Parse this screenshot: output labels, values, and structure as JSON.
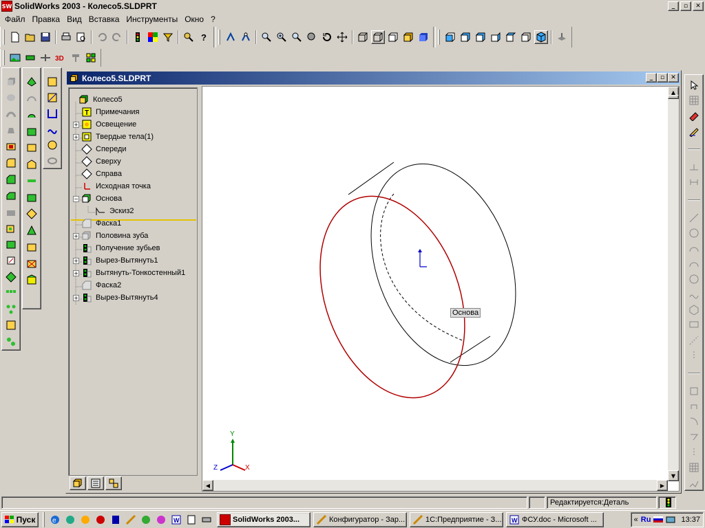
{
  "app": {
    "title": "SolidWorks 2003 - Колесо5.SLDPRT",
    "logo_text": "SW"
  },
  "menu": [
    "Файл",
    "Правка",
    "Вид",
    "Вставка",
    "Инструменты",
    "Окно",
    "?"
  ],
  "toolbar_top": [
    "new-document-icon",
    "open-icon",
    "save-icon",
    "print-icon",
    "print-preview-icon",
    "undo-icon",
    "redo-icon",
    "traffic-light-icon",
    "palette-icon",
    "options-icon",
    "select-icon",
    "help-icon",
    "zoom-fit-icon",
    "zoom-in-out-icon",
    "zoom-area-icon",
    "zoom-icon",
    "rotate-icon",
    "pan-icon",
    "wireframe-icon",
    "hidden-lines-visible-icon",
    "hidden-lines-removed-icon",
    "shaded-edges-icon",
    "shaded-icon",
    "front-view-icon",
    "back-view-icon",
    "left-view-icon",
    "right-view-icon",
    "top-view-icon",
    "isometric-view-icon",
    "normal-to-icon"
  ],
  "document": {
    "title": "Колесо5.SLDPRT",
    "tree": [
      {
        "label": "Колесо5",
        "icon": "part-icon",
        "indent": 0,
        "expand": ""
      },
      {
        "label": "Примечания",
        "icon": "annotations-icon",
        "indent": 1,
        "expand": ""
      },
      {
        "label": "Освещение",
        "icon": "lighting-icon",
        "indent": 1,
        "expand": "+"
      },
      {
        "label": "Твердые тела(1)",
        "icon": "solid-bodies-icon",
        "indent": 1,
        "expand": "+"
      },
      {
        "label": "Спереди",
        "icon": "plane-icon",
        "indent": 1,
        "expand": ""
      },
      {
        "label": "Сверху",
        "icon": "plane-icon",
        "indent": 1,
        "expand": ""
      },
      {
        "label": "Справа",
        "icon": "plane-icon",
        "indent": 1,
        "expand": ""
      },
      {
        "label": "Исходная точка",
        "icon": "origin-icon",
        "indent": 1,
        "expand": ""
      },
      {
        "label": "Основа",
        "icon": "extrude-icon",
        "indent": 1,
        "expand": "−"
      },
      {
        "label": "Эскиз2",
        "icon": "sketch-icon",
        "indent": 2,
        "expand": ""
      },
      {
        "label": "Фаска1",
        "icon": "chamfer-icon",
        "indent": 1,
        "expand": ""
      },
      {
        "label": "Половина зуба",
        "icon": "feature-icon",
        "indent": 1,
        "expand": "+"
      },
      {
        "label": "Получение зубьев",
        "icon": "pattern-icon",
        "indent": 1,
        "expand": ""
      },
      {
        "label": "Вырез-Вытянуть1",
        "icon": "cut-extrude-icon",
        "indent": 1,
        "expand": "+"
      },
      {
        "label": "Вытянуть-Тонкостенный1",
        "icon": "thin-extrude-icon",
        "indent": 1,
        "expand": "+"
      },
      {
        "label": "Фаска2",
        "icon": "chamfer-icon",
        "indent": 1,
        "expand": ""
      },
      {
        "label": "Вырез-Вытянуть4",
        "icon": "cut-extrude-icon",
        "indent": 1,
        "expand": "+"
      }
    ],
    "tooltip": "Основа",
    "axes": {
      "x": "X",
      "y": "Y",
      "z": "Z"
    },
    "tabs": [
      "feature-manager-tab-icon",
      "property-manager-tab-icon",
      "configuration-manager-tab-icon"
    ]
  },
  "status": {
    "editing": "Редактируется:Деталь"
  },
  "taskbar": {
    "start": "Пуск",
    "tasks": [
      {
        "label": "SolidWorks 2003...",
        "active": true
      },
      {
        "label": "Конфигуратор - Зар...",
        "active": false
      },
      {
        "label": "1С:Предприятие - З...",
        "active": false
      },
      {
        "label": "ФСУ.doc - Microsoft ...",
        "active": false
      }
    ],
    "lang": "Ru",
    "clock": "13:37"
  },
  "colors": {
    "title_gradient_start": "#0a246a",
    "title_gradient_end": "#a6caf0",
    "selected_edge": "#cc0000",
    "rollback_bar": "#e5c200"
  }
}
